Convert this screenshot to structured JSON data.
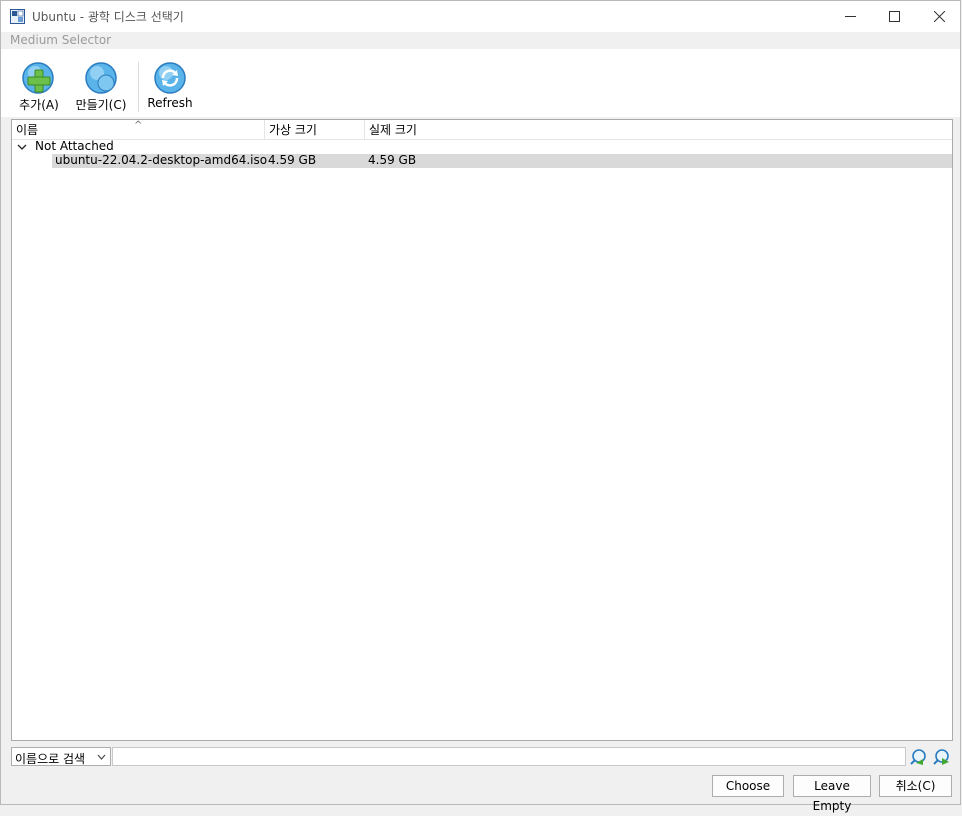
{
  "window": {
    "title": "Ubuntu - 광학 디스크 선택기",
    "subtitle": "Medium Selector",
    "controls": {
      "minimize": "—",
      "maximize": "☐",
      "close": "✕"
    }
  },
  "toolbar": {
    "add_label": "추가(A)",
    "create_label": "만들기(C)",
    "refresh_label": "Refresh"
  },
  "tree": {
    "columns": [
      "이름",
      "가상 크기",
      "실제 크기"
    ],
    "sort_indicator": "^",
    "groups": [
      {
        "label": "Not Attached",
        "rows": [
          {
            "name": "ubuntu-22.04.2-desktop-amd64.iso",
            "virtual_size": "4.59 GB",
            "actual_size": "4.59 GB",
            "selected": true
          }
        ]
      }
    ]
  },
  "search": {
    "mode_selected": "이름으로 검색",
    "value": ""
  },
  "buttons": {
    "choose": "Choose",
    "leave_empty": "Leave Empty",
    "cancel": "취소(C)"
  },
  "colors": {
    "accent": "#3a96dd",
    "selection": "#d9d9d9"
  },
  "icons": {
    "add": "add-disk-icon",
    "create": "create-disk-icon",
    "refresh": "refresh-icon",
    "search_back": "search-back-icon",
    "search_forward": "search-forward-icon"
  }
}
